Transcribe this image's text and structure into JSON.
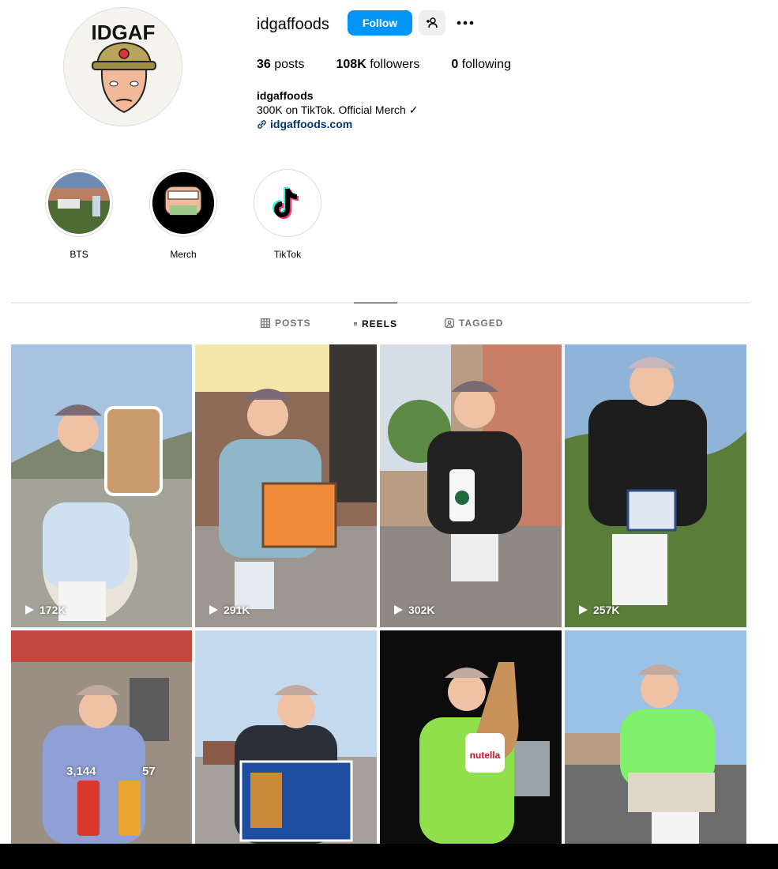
{
  "profile": {
    "avatar_logo_text": "IDGAF",
    "username": "idgaffoods",
    "follow_label": "Follow",
    "stats": {
      "posts_count": "36",
      "posts_label": "posts",
      "followers_count": "108K",
      "followers_label": "followers",
      "following_count": "0",
      "following_label": "following"
    },
    "bio": {
      "name": "idgaffoods",
      "text": "300K on TikTok. Official Merch ✓",
      "link": "idgaffoods.com"
    }
  },
  "highlights": [
    {
      "label": "BTS"
    },
    {
      "label": "Merch"
    },
    {
      "label": "TikTok"
    }
  ],
  "tabs": [
    {
      "label": "POSTS",
      "icon": "grid-icon"
    },
    {
      "label": "REELS",
      "icon": "reels-icon",
      "active": true
    },
    {
      "label": "TAGGED",
      "icon": "tagged-icon"
    }
  ],
  "reels": [
    {
      "views": "172K"
    },
    {
      "views": "291K"
    },
    {
      "views": "302K"
    },
    {
      "views": "257K"
    },
    {
      "overlay_left": "3,144",
      "overlay_right": "57"
    },
    {},
    {},
    {}
  ],
  "colors": {
    "follow_button": "#0095f6",
    "link": "#00376b",
    "divider": "#dbdbdb"
  }
}
